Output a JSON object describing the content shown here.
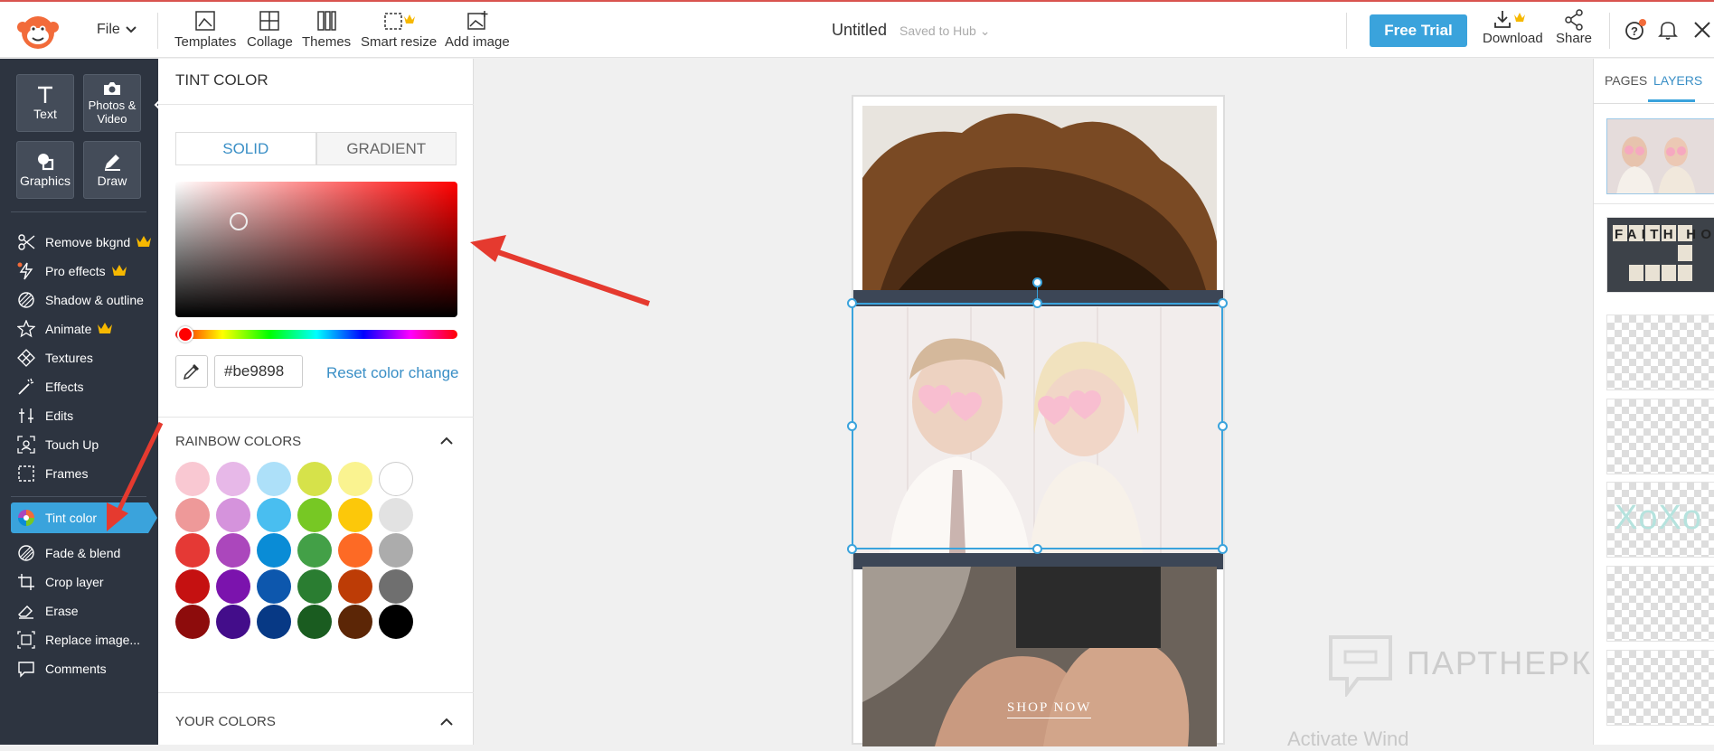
{
  "topbar": {
    "file_label": "File",
    "tools": [
      {
        "label": "Templates",
        "icon": "templates-icon"
      },
      {
        "label": "Collage",
        "icon": "collage-icon"
      },
      {
        "label": "Themes",
        "icon": "themes-icon"
      },
      {
        "label": "Smart resize",
        "icon": "smart-resize-icon"
      },
      {
        "label": "Add image",
        "icon": "add-image-icon"
      }
    ],
    "doc_title": "Untitled",
    "saved_status": "Saved to Hub",
    "free_trial": "Free Trial",
    "download": "Download",
    "share": "Share"
  },
  "leftnav": {
    "big_buttons": [
      {
        "label": "Text",
        "icon": "text-icon"
      },
      {
        "label": "Photos & Video",
        "icon": "camera-icon"
      },
      {
        "label": "Graphics",
        "icon": "graphics-icon"
      },
      {
        "label": "Draw",
        "icon": "pencil-icon"
      }
    ],
    "items": [
      {
        "label": "Remove bkgnd",
        "icon": "scissors-icon",
        "premium": true
      },
      {
        "label": "Pro effects",
        "icon": "lightning-icon",
        "premium": true
      },
      {
        "label": "Shadow & outline",
        "icon": "shadow-icon",
        "premium": false
      },
      {
        "label": "Animate",
        "icon": "star-icon",
        "premium": true
      },
      {
        "label": "Textures",
        "icon": "textures-icon",
        "premium": false
      },
      {
        "label": "Effects",
        "icon": "magic-wand-icon",
        "premium": false
      },
      {
        "label": "Edits",
        "icon": "sliders-icon",
        "premium": false
      },
      {
        "label": "Touch Up",
        "icon": "face-icon",
        "premium": false
      },
      {
        "label": "Frames",
        "icon": "frame-icon",
        "premium": false
      },
      {
        "label": "Tint color",
        "icon": "color-wheel-icon",
        "premium": false,
        "active": true
      },
      {
        "label": "Fade & blend",
        "icon": "fade-icon",
        "premium": false
      },
      {
        "label": "Crop layer",
        "icon": "crop-icon",
        "premium": false
      },
      {
        "label": "Erase",
        "icon": "eraser-icon",
        "premium": false
      },
      {
        "label": "Replace image...",
        "icon": "replace-icon",
        "premium": false
      },
      {
        "label": "Comments",
        "icon": "comment-icon",
        "premium": false
      }
    ]
  },
  "panel": {
    "title": "TINT COLOR",
    "tabs": [
      "SOLID",
      "GRADIENT"
    ],
    "hex_value": "#be9898",
    "reset_label": "Reset color change",
    "rainbow_title": "RAINBOW COLORS",
    "your_colors_title": "YOUR COLORS",
    "swatches": [
      [
        "#f9c8d2",
        "#e7b8e8",
        "#ade0f9",
        "#d6e24a",
        "#faf390",
        "#ffffff"
      ],
      [
        "#ee9999",
        "#d593dc",
        "#49bef0",
        "#77c824",
        "#fcc80a",
        "#e2e2e2"
      ],
      [
        "#e53935",
        "#ab47bc",
        "#0a8cd6",
        "#43a047",
        "#fd6a25",
        "#acacac"
      ],
      [
        "#c51111",
        "#7b13ad",
        "#0d57ad",
        "#2a7d31",
        "#bd3c06",
        "#6f6f6f"
      ],
      [
        "#8d0c0c",
        "#430d8a",
        "#073985",
        "#1a5c20",
        "#5c2606",
        "#000000"
      ]
    ]
  },
  "canvas": {
    "watermark": "ПАРТНЕРКИН",
    "shop_now": "SHOP NOW",
    "activate_text": "Activate Wind"
  },
  "rightpanel": {
    "tabs": [
      "PAGES",
      "LAYERS"
    ],
    "layers": [
      {
        "name": "couple-photo-layer",
        "kind": "photo"
      },
      {
        "name": "faith-hope-love-layer",
        "text": "FAITH HOPE LOVE"
      },
      {
        "name": "transparent-layer-1",
        "kind": "empty"
      },
      {
        "name": "transparent-layer-2",
        "kind": "empty"
      },
      {
        "name": "xoxo-text-layer",
        "text": "XoXo"
      },
      {
        "name": "transparent-layer-3",
        "kind": "empty"
      },
      {
        "name": "transparent-layer-4",
        "kind": "empty"
      }
    ]
  }
}
